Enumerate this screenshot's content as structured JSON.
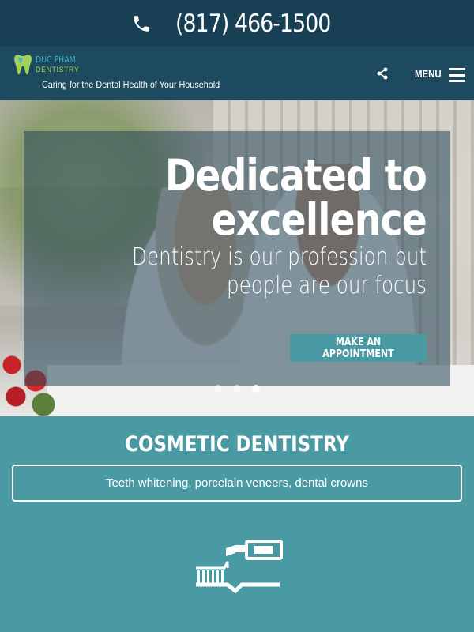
{
  "phone_bar": {
    "phone": "(817) 466-1500",
    "icon": "phone-icon"
  },
  "header": {
    "logo_line1": "DUC PHAM",
    "logo_line2": "DENTISTRY",
    "tagline": "Caring for the Dental Health of Your Household",
    "share_icon": "share-icon",
    "menu_label": "MENU",
    "menu_icon": "hamburger-icon"
  },
  "hero": {
    "title": "Dedicated to excellence",
    "subtitle": "Dentistry is our profession but people are our focus",
    "cta_label": "MAKE AN APPOINTMENT",
    "slide_count": 3,
    "active_slide": 3
  },
  "section": {
    "title": "COSMETIC DENTISTRY",
    "description": "Teeth whitening, porcelain veneers, dental crowns",
    "icon": "toothbrush-toothpaste-icon"
  },
  "colors": {
    "phone_bar_bg": "#183f54",
    "header_bg": "#1d4a5f",
    "accent_teal": "#4a9aa3",
    "logo_blue": "#3ab3c8",
    "logo_green": "#9fd25a"
  }
}
